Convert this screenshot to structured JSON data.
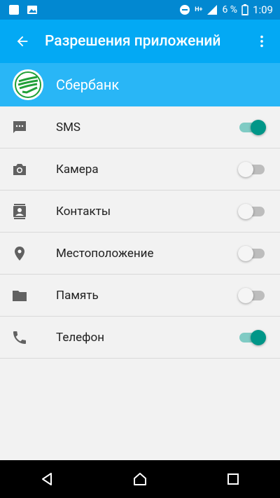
{
  "statusbar": {
    "battery": "6 %",
    "time": "1:09",
    "network": "H+"
  },
  "appbar": {
    "title": "Разрешения приложений"
  },
  "app": {
    "name": "Сбербанк"
  },
  "permissions": [
    {
      "label": "SMS",
      "icon": "sms-icon",
      "enabled": true
    },
    {
      "label": "Камера",
      "icon": "camera-icon",
      "enabled": false
    },
    {
      "label": "Контакты",
      "icon": "contacts-icon",
      "enabled": false
    },
    {
      "label": "Местоположение",
      "icon": "location-icon",
      "enabled": false
    },
    {
      "label": "Память",
      "icon": "folder-icon",
      "enabled": false
    },
    {
      "label": "Телефон",
      "icon": "phone-icon",
      "enabled": true
    }
  ],
  "colors": {
    "statusbar": "#0288d1",
    "appbar": "#03a9f4",
    "appheader": "#29b6f6",
    "toggle_on": "#009688"
  }
}
